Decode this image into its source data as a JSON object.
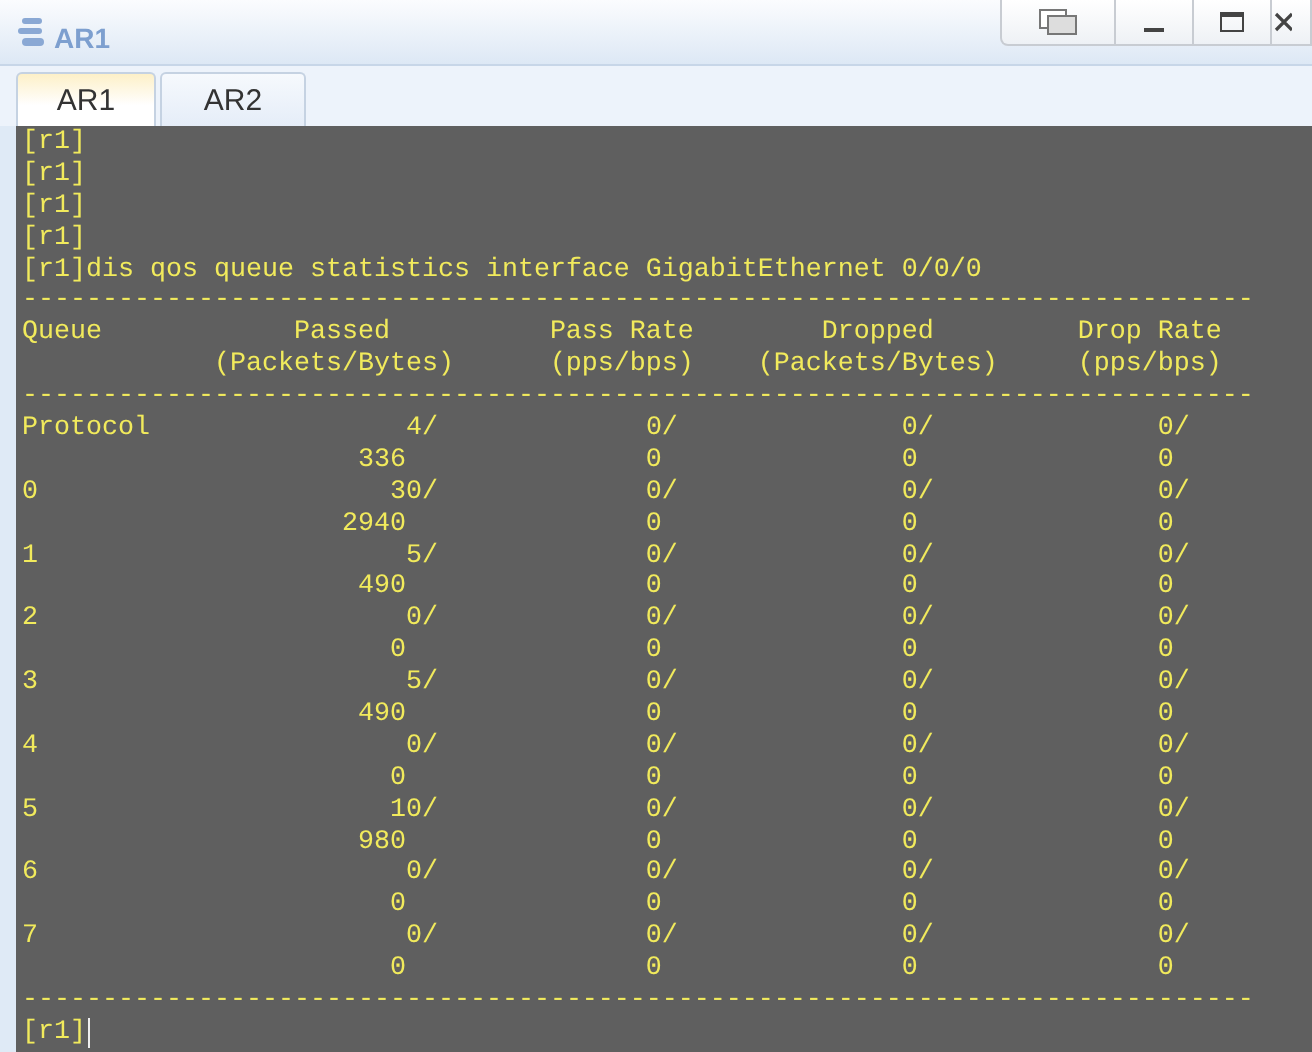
{
  "window": {
    "title": "AR1",
    "controls": [
      {
        "kind": "restore"
      },
      {
        "kind": "minimize"
      },
      {
        "kind": "maximize"
      },
      {
        "kind": "close"
      }
    ]
  },
  "tabs": [
    {
      "label": "AR1",
      "selected": true
    },
    {
      "label": "AR2",
      "selected": false
    }
  ],
  "terminal": {
    "prompts": [
      "[r1]",
      "[r1]",
      "[r1]",
      "[r1]"
    ],
    "command": "[r1]dis qos queue statistics interface GigabitEthernet 0/0/0",
    "separator": "-----------------------------------------------------------------------------",
    "headers": [
      {
        "title": "Queue"
      },
      {
        "title": "Passed",
        "unit": "(Packets/Bytes)"
      },
      {
        "title": "Pass Rate",
        "unit": "(pps/bps)"
      },
      {
        "title": "Dropped",
        "unit": "(Packets/Bytes)"
      },
      {
        "title": "Drop Rate",
        "unit": "(pps/bps)"
      }
    ],
    "rows": [
      {
        "queue": "Protocol",
        "passed": [
          "4/",
          "336"
        ],
        "pass_rate": [
          "0/",
          "0"
        ],
        "dropped": [
          "0/",
          "0"
        ],
        "drop_rate": [
          "0/",
          "0"
        ]
      },
      {
        "queue": "0",
        "passed": [
          "30/",
          "2940"
        ],
        "pass_rate": [
          "0/",
          "0"
        ],
        "dropped": [
          "0/",
          "0"
        ],
        "drop_rate": [
          "0/",
          "0"
        ]
      },
      {
        "queue": "1",
        "passed": [
          "5/",
          "490"
        ],
        "pass_rate": [
          "0/",
          "0"
        ],
        "dropped": [
          "0/",
          "0"
        ],
        "drop_rate": [
          "0/",
          "0"
        ]
      },
      {
        "queue": "2",
        "passed": [
          "0/",
          "0"
        ],
        "pass_rate": [
          "0/",
          "0"
        ],
        "dropped": [
          "0/",
          "0"
        ],
        "drop_rate": [
          "0/",
          "0"
        ]
      },
      {
        "queue": "3",
        "passed": [
          "5/",
          "490"
        ],
        "pass_rate": [
          "0/",
          "0"
        ],
        "dropped": [
          "0/",
          "0"
        ],
        "drop_rate": [
          "0/",
          "0"
        ]
      },
      {
        "queue": "4",
        "passed": [
          "0/",
          "0"
        ],
        "pass_rate": [
          "0/",
          "0"
        ],
        "dropped": [
          "0/",
          "0"
        ],
        "drop_rate": [
          "0/",
          "0"
        ]
      },
      {
        "queue": "5",
        "passed": [
          "10/",
          "980"
        ],
        "pass_rate": [
          "0/",
          "0"
        ],
        "dropped": [
          "0/",
          "0"
        ],
        "drop_rate": [
          "0/",
          "0"
        ]
      },
      {
        "queue": "6",
        "passed": [
          "0/",
          "0"
        ],
        "pass_rate": [
          "0/",
          "0"
        ],
        "dropped": [
          "0/",
          "0"
        ],
        "drop_rate": [
          "0/",
          "0"
        ]
      },
      {
        "queue": "7",
        "passed": [
          "0/",
          "0"
        ],
        "pass_rate": [
          "0/",
          "0"
        ],
        "dropped": [
          "0/",
          "0"
        ],
        "drop_rate": [
          "0/",
          "0"
        ]
      }
    ],
    "final_prompt": "[r1]"
  }
}
